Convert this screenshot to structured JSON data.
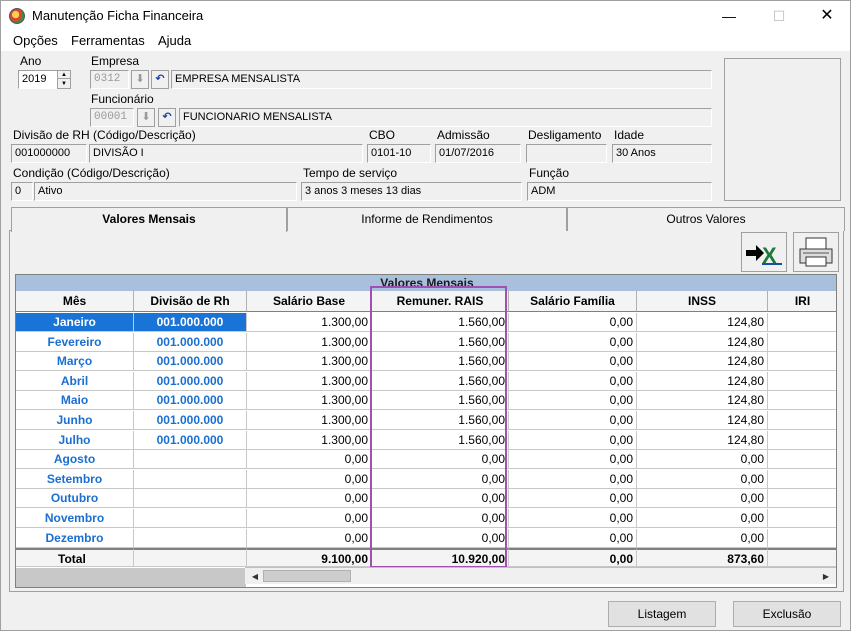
{
  "window": {
    "title": "Manutenção Ficha Financeira",
    "minimize": "—",
    "maximize": "☐",
    "close": "✕"
  },
  "menu": [
    "Opções",
    "Ferramentas",
    "Ajuda"
  ],
  "form": {
    "ano_label": "Ano",
    "ano_value": "2019",
    "empresa_label": "Empresa",
    "empresa_code": "0312",
    "empresa_name": "EMPRESA MENSALISTA",
    "funcionario_label": "Funcionário",
    "funcionario_code": "00001",
    "funcionario_name": "FUNCIONARIO MENSALISTA",
    "divisao_label": "Divisão de RH (Código/Descrição)",
    "divisao_code": "001000000",
    "divisao_desc": "DIVISÃO I",
    "cbo_label": "CBO",
    "cbo_value": "0101-10",
    "admissao_label": "Admissão",
    "admissao_value": "01/07/2016",
    "desligamento_label": "Desligamento",
    "desligamento_value": "",
    "idade_label": "Idade",
    "idade_value": "30 Anos",
    "condicao_label": "Condição (Código/Descrição)",
    "condicao_code": "0",
    "condicao_desc": "Ativo",
    "tempo_label": "Tempo de serviço",
    "tempo_value": "3 anos 3 meses 13 dias",
    "funcao_label": "Função",
    "funcao_value": "ADM"
  },
  "tabs": [
    "Valores Mensais",
    "Informe de Rendimentos",
    "Outros Valores"
  ],
  "grid": {
    "caption": "Valores Mensais",
    "columns": [
      "Mês",
      "Divisão de Rh",
      "Salário Base",
      "Remuner. RAIS",
      "Salário Família",
      "INSS",
      "IRI"
    ],
    "rows": [
      [
        "Janeiro",
        "001.000.000",
        "1.300,00",
        "1.560,00",
        "0,00",
        "124,80"
      ],
      [
        "Fevereiro",
        "001.000.000",
        "1.300,00",
        "1.560,00",
        "0,00",
        "124,80"
      ],
      [
        "Março",
        "001.000.000",
        "1.300,00",
        "1.560,00",
        "0,00",
        "124,80"
      ],
      [
        "Abril",
        "001.000.000",
        "1.300,00",
        "1.560,00",
        "0,00",
        "124,80"
      ],
      [
        "Maio",
        "001.000.000",
        "1.300,00",
        "1.560,00",
        "0,00",
        "124,80"
      ],
      [
        "Junho",
        "001.000.000",
        "1.300,00",
        "1.560,00",
        "0,00",
        "124,80"
      ],
      [
        "Julho",
        "001.000.000",
        "1.300,00",
        "1.560,00",
        "0,00",
        "124,80"
      ],
      [
        "Agosto",
        "",
        "0,00",
        "0,00",
        "0,00",
        "0,00"
      ],
      [
        "Setembro",
        "",
        "0,00",
        "0,00",
        "0,00",
        "0,00"
      ],
      [
        "Outubro",
        "",
        "0,00",
        "0,00",
        "0,00",
        "0,00"
      ],
      [
        "Novembro",
        "",
        "0,00",
        "0,00",
        "0,00",
        "0,00"
      ],
      [
        "Dezembro",
        "",
        "0,00",
        "0,00",
        "0,00",
        "0,00"
      ]
    ],
    "total": [
      "Total",
      "",
      "9.100,00",
      "10.920,00",
      "0,00",
      "873,60"
    ]
  },
  "buttons": {
    "listagem": "Listagem",
    "exclusao": "Exclusão"
  },
  "colors": {
    "accent": "#1a73d6",
    "highlight": "#a050b0",
    "month_text": "#1a6fd0"
  }
}
